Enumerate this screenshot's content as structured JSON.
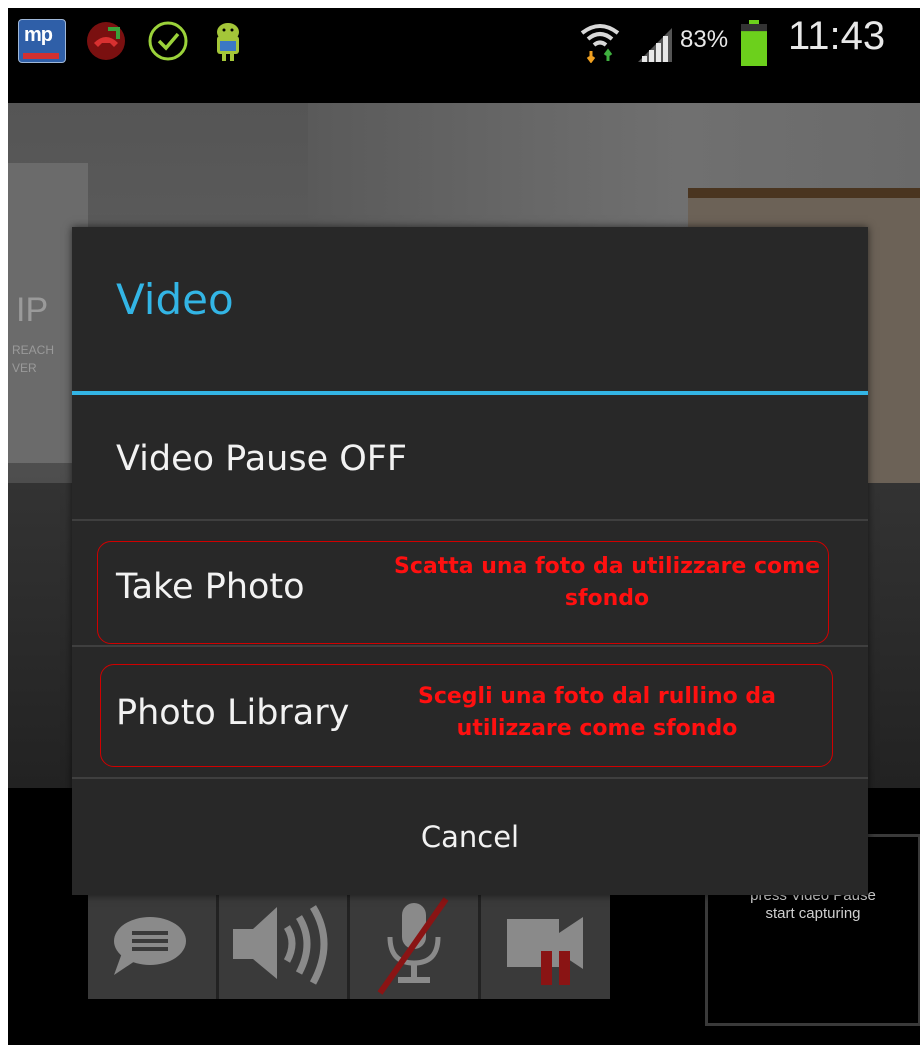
{
  "status_bar": {
    "app_icon_text": "mp",
    "battery_percent": "83%",
    "battery_level": 0.83,
    "time": "11:43",
    "icons": [
      "mp-app-icon",
      "missed-call-icon",
      "check-circle-icon",
      "android-icon",
      "wifi-icon",
      "signal-icon",
      "battery-icon"
    ]
  },
  "background": {
    "wall_text_1": "IP",
    "wall_text_2": "REACH",
    "wall_text_3": "VER",
    "preview_line_1": "press Video Pause",
    "preview_line_2": "start capturing"
  },
  "toolbar": {
    "buttons": [
      "chat-icon",
      "speaker-icon",
      "mic-muted-icon",
      "video-paused-icon"
    ]
  },
  "dialog": {
    "title": "Video",
    "title_color": "#33b5e5",
    "items": [
      {
        "label": "Video Pause OFF"
      },
      {
        "label": "Take Photo",
        "annotation": "Scatta una foto da utilizzare come sfondo"
      },
      {
        "label": "Photo Library",
        "annotation": "Scegli una foto dal rullino da utilizzare come sfondo"
      }
    ],
    "cancel_label": "Cancel"
  },
  "colors": {
    "accent": "#33b5e5",
    "annotation": "#ff1010",
    "dialog_bg": "#282828",
    "battery_green": "#6cd01c"
  }
}
